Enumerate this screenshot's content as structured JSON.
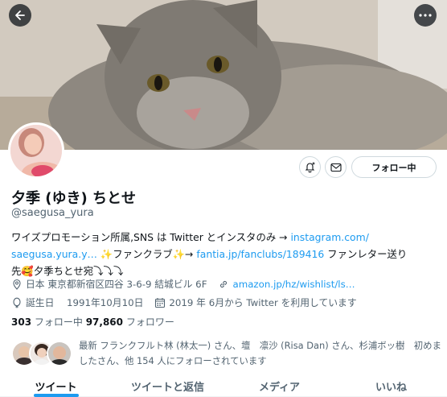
{
  "header": {
    "back_icon": "arrow-left-icon",
    "more_icon": "more-horizontal-icon"
  },
  "profile": {
    "display_name": "夕季 (ゆき) ちとせ",
    "handle": "@saegusa_yura",
    "follow_button_label": "フォロー中",
    "bio": {
      "line1_text": "ワイズプロモーション所属,SNS は Twitter とインスタのみ → ",
      "line1_link": "instagram.com/",
      "line2_link": "saegusa.yura.y…",
      "line2_text": " ✨ファンクラブ✨→ ",
      "line2_link2": "fantia.jp/fanclubs/189416",
      "line2_text2": " ファンレター送り",
      "line3_text": "先🥰夕季ちとせ宛⤵︎⤵︎⤵︎"
    },
    "location": "日本 東京都新宿区四谷 3-6-9 結城ビル 6F",
    "website": "amazon.jp/hz/wishlist/ls…",
    "birthday": "誕生日　 1991年10月10日",
    "joined": "2019 年 6月から Twitter を利用しています",
    "following_count": "303",
    "following_label": " フォロー中 ",
    "followers_count": "97,860",
    "followers_label": " フォロワー",
    "known_followers_text": "最新 フランクフルト林 (林太一) さん、壇　凛沙 (Risa Dan) さん、杉浦ボッ樹　初めましたさん、他 154 人にフォローされています"
  },
  "tabs": [
    {
      "label": "ツイート",
      "active": true
    },
    {
      "label": "ツイートと返信",
      "active": false
    },
    {
      "label": "メディア",
      "active": false
    },
    {
      "label": "いいね",
      "active": false
    }
  ],
  "colors": {
    "accent": "#1d9bf0",
    "text": "#0f1419",
    "secondary": "#536471"
  }
}
